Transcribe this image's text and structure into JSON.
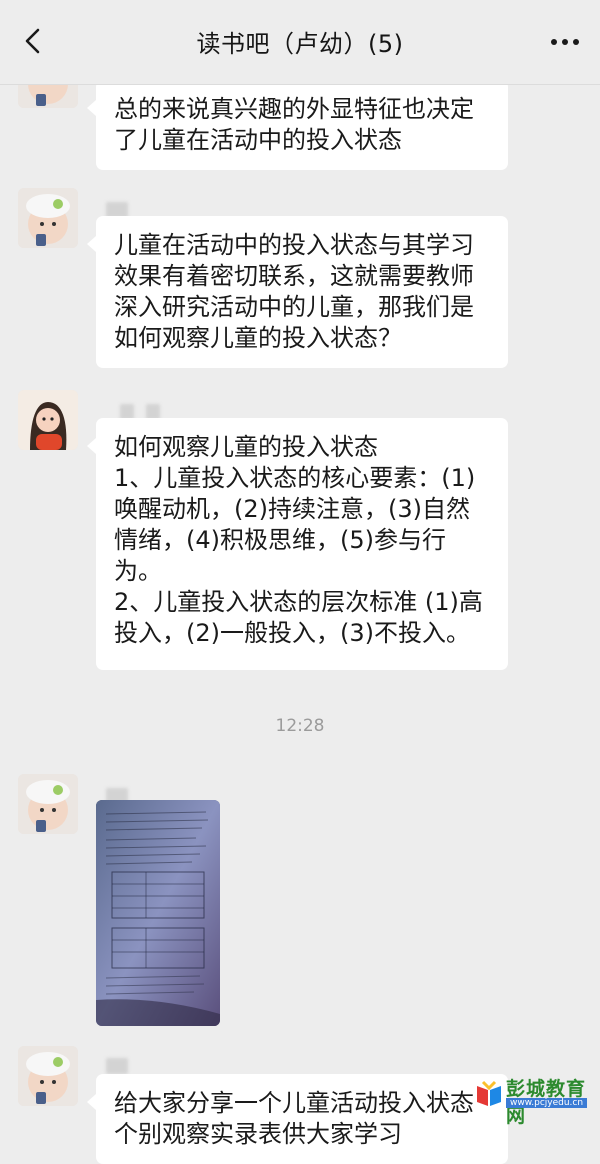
{
  "header": {
    "title": "读书吧（卢幼）(5)",
    "back_icon": "chevron-left-icon",
    "more_icon": "ellipsis-icon"
  },
  "messages": [
    {
      "text": "总的来说真兴趣的外显特征也决定\n了儿童在活动中的投入状态"
    },
    {
      "text": "儿童在活动中的投入状态与其学习\n效果有着密切联系，这就需要教师\n深入研究活动中的儿童，那我们是\n如何观察儿童的投入状态？"
    },
    {
      "text": "如何观察儿童的投入状态\n1、儿童投入状态的核心要素：(1)\n唤醒动机，(2)持续注意，(3)自然\n情绪，(4)积极思维，(5)参与行\n为。\n2、儿童投入状态的层次标准 (1)高\n投入，(2)一般投入，(3)不投入。"
    },
    {
      "text": "给大家分享一个儿童活动投入状态\n个别观察实录表供大家学习"
    }
  ],
  "timestamp": "12:28",
  "watermark": {
    "name": "彭城教育网",
    "url": "www.pcjyedu.cn"
  },
  "colors": {
    "background": "#ededed",
    "bubble": "#ffffff",
    "watermark_green": "#2c8a2e"
  }
}
